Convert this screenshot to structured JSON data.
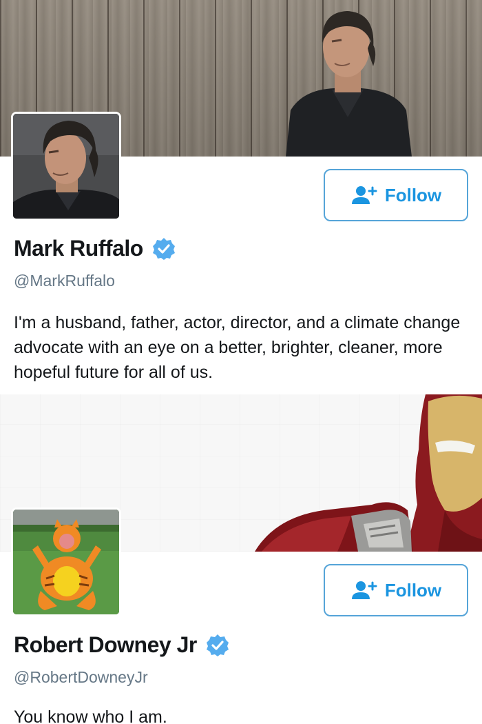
{
  "profiles": [
    {
      "display_name": "Mark Ruffalo",
      "handle": "@MarkRuffalo",
      "verified": true,
      "bio": "I'm a husband, father, actor, director, and a climate change advocate with an eye on a better, brighter, cleaner, more hopeful future for all of us.",
      "follow_label": "Follow",
      "follow_icon": "add-user-icon",
      "banner": "wooden-fence-portrait"
    },
    {
      "display_name": "Robert Downey Jr",
      "handle": "@RobertDowneyJr",
      "verified": true,
      "bio": "You know who I am.",
      "follow_label": "Follow",
      "follow_icon": "add-user-icon",
      "banner": "iron-man-helmet"
    }
  ],
  "colors": {
    "accent": "#1b95e0",
    "button_border": "#55a4d8",
    "verified_badge": "#55acee",
    "handle_text": "#657786",
    "name_text": "#14171a"
  }
}
